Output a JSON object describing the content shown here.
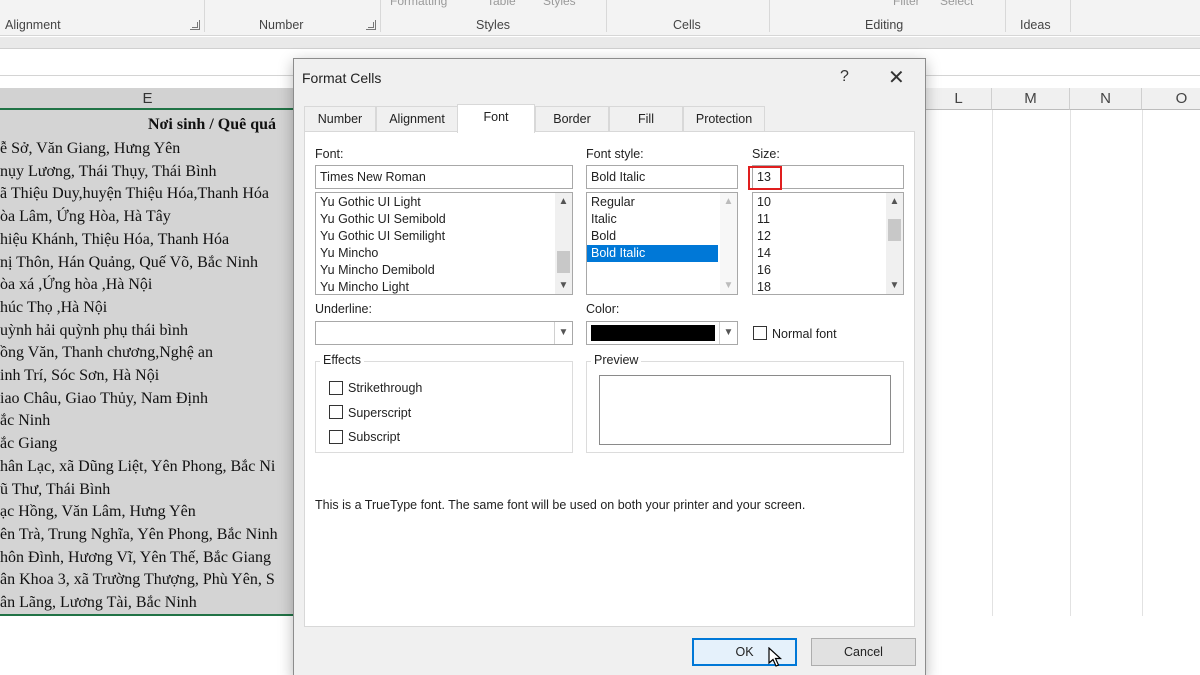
{
  "ribbon": {
    "groups": [
      "Alignment",
      "Number",
      "Styles",
      "Cells",
      "Editing",
      "Ideas"
    ],
    "cut_labels": [
      "Formatting",
      "Table",
      "Styles",
      "Filter",
      "Select"
    ]
  },
  "sheet": {
    "columns": [
      "E",
      "L",
      "M",
      "N",
      "O"
    ],
    "header_cell": "Nơi sinh / Quê quá",
    "rows": [
      "ễ Sở, Văn Giang, Hưng Yên",
      "nụy Lương, Thái Thụy, Thái Bình",
      "ã Thiệu Duy,huyện Thiệu Hóa,Thanh Hóa",
      "òa Lâm, Ứng Hòa, Hà Tây",
      "hiệu Khánh, Thiệu Hóa, Thanh Hóa",
      "nị Thôn, Hán Quảng, Quế Võ, Bắc Ninh",
      "òa xá ,Ứng hòa ,Hà Nội",
      "húc Thọ ,Hà Nội",
      "uỳnh hải quỳnh phụ thái bình",
      "ồng Văn, Thanh chương,Nghệ an",
      "inh Trí, Sóc Sơn, Hà Nội",
      "iao Châu, Giao Thủy, Nam Định",
      "ắc Ninh",
      "ắc Giang",
      "hân Lạc, xã Dũng Liệt, Yên Phong, Bắc Ni",
      "ũ Thư, Thái Bình",
      "ạc Hồng, Văn Lâm, Hưng Yên",
      "ên Trà, Trung Nghĩa, Yên Phong, Bắc Ninh",
      "hôn Đình, Hương Vĩ, Yên Thế, Bắc Giang",
      "ân Khoa 3, xã Trường Thượng, Phù Yên, S",
      "ân Lãng, Lương Tài, Bắc Ninh"
    ]
  },
  "dialog": {
    "title": "Format Cells",
    "help": "?",
    "close": "✕",
    "tabs": [
      "Number",
      "Alignment",
      "Font",
      "Border",
      "Fill",
      "Protection"
    ],
    "active_tab": "Font",
    "font": {
      "label": "Font:",
      "value": "Times New Roman",
      "list": [
        "Yu Gothic UI Light",
        "Yu Gothic UI Semibold",
        "Yu Gothic UI Semilight",
        "Yu Mincho",
        "Yu Mincho Demibold",
        "Yu Mincho Light"
      ]
    },
    "style": {
      "label": "Font style:",
      "value": "Bold Italic",
      "list": [
        "Regular",
        "Italic",
        "Bold",
        "Bold Italic"
      ],
      "selected": "Bold Italic"
    },
    "size": {
      "label": "Size:",
      "value": "13",
      "list": [
        "10",
        "11",
        "12",
        "14",
        "16",
        "18"
      ]
    },
    "underline": {
      "label": "Underline:",
      "value": ""
    },
    "color": {
      "label": "Color:",
      "swatch": "#000000"
    },
    "normal_font": "Normal font",
    "effects": {
      "label": "Effects",
      "items": [
        "Strikethrough",
        "Superscript",
        "Subscript"
      ]
    },
    "preview": {
      "label": "Preview"
    },
    "info": "This is a TrueType font.  The same font will be used on both your printer and your screen.",
    "ok": "OK",
    "cancel": "Cancel"
  },
  "colors": {
    "accent": "#0078d7",
    "highlight": "#e01e1e",
    "excel_green": "#217346"
  }
}
